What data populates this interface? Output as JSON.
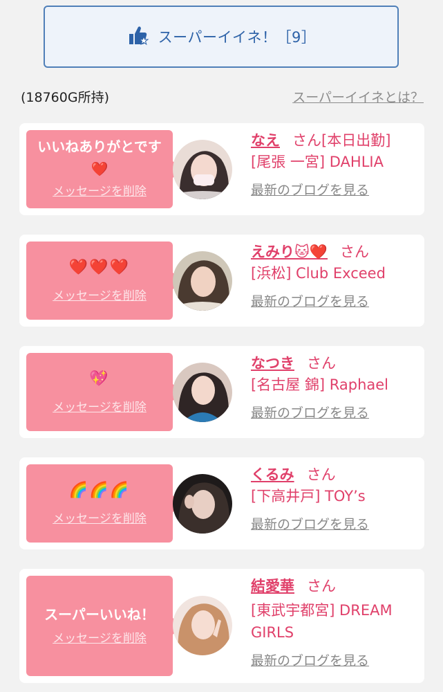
{
  "super_like": {
    "label": "スーパーイイネ！［9］",
    "icon": "thumbs-up-star-icon"
  },
  "balance_text": "(18760G所持)",
  "about_link": "スーパーイイネとは？",
  "colors": {
    "accent": "#e0406a",
    "bubble": "#f7909f",
    "link_blue": "#2d62a8"
  },
  "cards": [
    {
      "message": "いいねありがとです❤️",
      "delete_label": "メッセージを削除",
      "name": "なえ",
      "honorific": "さん[本日出勤]",
      "shop": "[尾張 一宮] DAHLIA",
      "blog_label": "最新のブログを見る"
    },
    {
      "message": "❤️❤️❤️",
      "delete_label": "メッセージを削除",
      "name": "えみり🐱❤️",
      "honorific": "さん",
      "shop": "[浜松] Club Exceed",
      "blog_label": "最新のブログを見る"
    },
    {
      "message": "💖",
      "delete_label": "メッセージを削除",
      "name": "なつき",
      "honorific": "さん",
      "shop": "[名古屋 錦] Raphael",
      "blog_label": "最新のブログを見る"
    },
    {
      "message": "🌈🌈🌈",
      "delete_label": "メッセージを削除",
      "name": "くるみ",
      "honorific": "さん",
      "shop": "[下高井戸] TOY’s",
      "blog_label": "最新のブログを見る"
    },
    {
      "message": "スーパーいいね！",
      "delete_label": "メッセージを削除",
      "name": "結愛華",
      "honorific": "さん",
      "shop": "[東武宇都宮] DREAM GIRLS",
      "blog_label": "最新のブログを見る"
    }
  ]
}
